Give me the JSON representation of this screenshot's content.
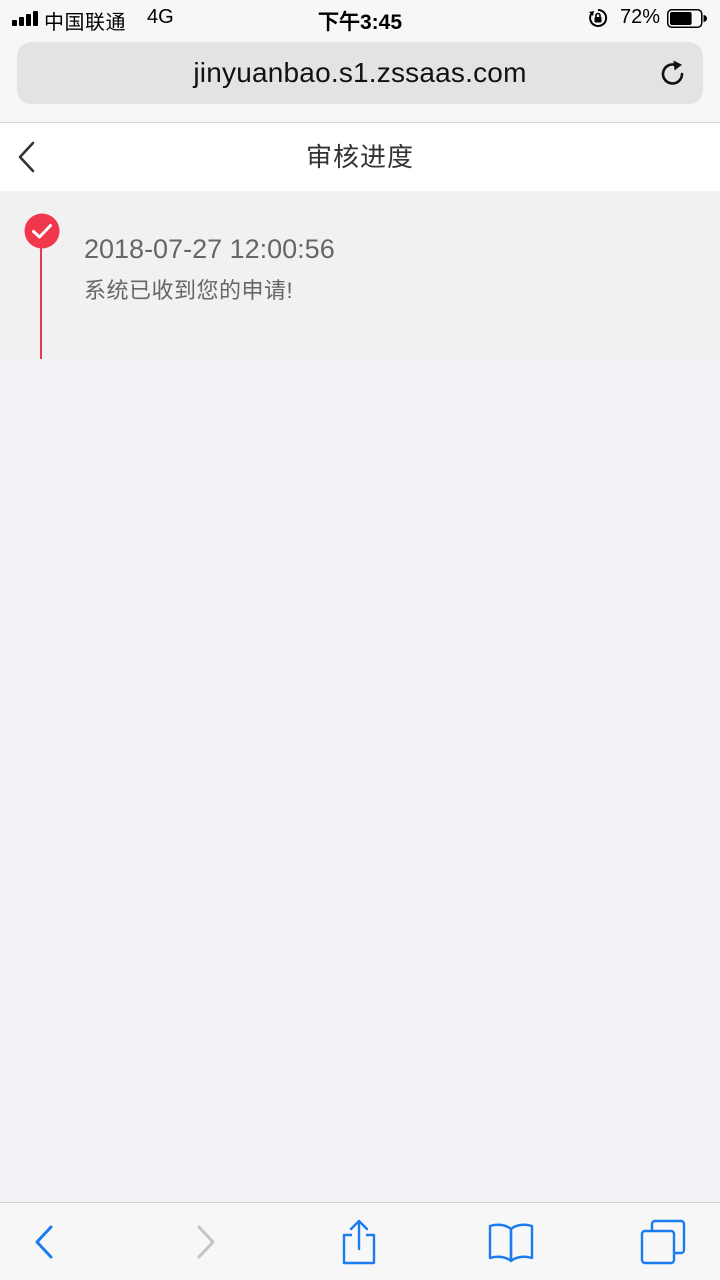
{
  "status_bar": {
    "carrier": "中国联通",
    "network": "4G",
    "time": "下午3:45",
    "battery_percent": "72%",
    "battery_level": 0.72
  },
  "browser": {
    "url": "jinyuanbao.s1.zssaas.com",
    "accent_color": "#1b7cf0"
  },
  "header": {
    "title": "审核进度"
  },
  "timeline": {
    "accent_color": "#e53a4c",
    "items": [
      {
        "time": "2018-07-27 12:00:56",
        "description": "系统已收到您的申请!"
      }
    ]
  },
  "icons": {
    "back": "chevron-left-icon",
    "reload": "reload-icon",
    "forward": "chevron-right-icon",
    "share": "share-icon",
    "bookmarks": "book-icon",
    "tabs": "tabs-icon"
  }
}
